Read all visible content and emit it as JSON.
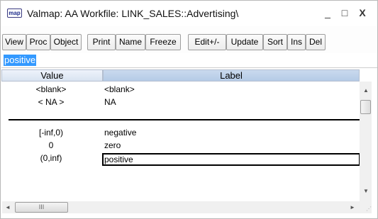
{
  "window": {
    "icon_label": "map",
    "title": "Valmap: AA   Workfile: LINK_SALES::Advertising\\",
    "minimize_glyph": "_",
    "maximize_glyph": "□",
    "close_glyph": "X"
  },
  "toolbar": {
    "buttons": [
      "View",
      "Proc",
      "Object",
      "Print",
      "Name",
      "Freeze",
      "Edit+/-",
      "Update",
      "Sort",
      "Ins",
      "Del"
    ]
  },
  "edit_field": {
    "value": "positive"
  },
  "grid": {
    "headers": [
      "Value",
      "Label"
    ],
    "rows_top": [
      {
        "value": "<blank>",
        "label": "<blank>"
      },
      {
        "value": "< NA >",
        "label": "NA"
      }
    ],
    "rows_main": [
      {
        "value": "[-inf,0)",
        "label": "negative"
      },
      {
        "value": "0",
        "label": "zero"
      },
      {
        "value": "(0,inf)",
        "label": "positive"
      }
    ]
  },
  "scrollbars": {
    "up_arrow": "▲",
    "down_arrow": "▼",
    "left_arrow": "◄",
    "right_arrow": "►",
    "thumb_glyph": "III"
  }
}
